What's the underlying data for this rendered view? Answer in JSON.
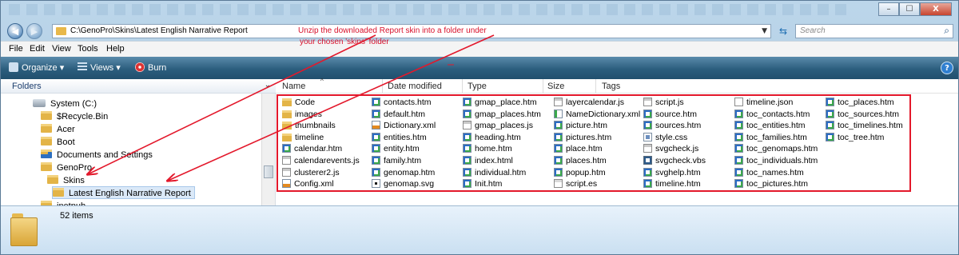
{
  "window": {
    "controls": {
      "minimize": "–",
      "maximize": "☐",
      "close": "X"
    }
  },
  "address": {
    "path": "C:\\GenoPro\\Skins\\Latest English Narrative Report",
    "search_placeholder": "Search"
  },
  "menu": [
    "File",
    "Edit",
    "View",
    "Tools",
    "Help"
  ],
  "toolbar": {
    "organize": "Organize",
    "views": "Views",
    "burn": "Burn",
    "help": "?"
  },
  "nav": {
    "header": "Folders",
    "items": [
      {
        "label": "System (C:)",
        "icon": "drive-icon"
      },
      {
        "label": "$Recycle.Bin",
        "icon": "folder-icon"
      },
      {
        "label": "Acer",
        "icon": "folder-icon"
      },
      {
        "label": "Boot",
        "icon": "folder-icon"
      },
      {
        "label": "Documents and Settings",
        "icon": "folder-shortcut-icon"
      },
      {
        "label": "GenoPro",
        "icon": "folder-icon"
      },
      {
        "label": "Skins",
        "icon": "folder-icon"
      },
      {
        "label": "Latest English Narrative Report",
        "icon": "folder-icon"
      },
      {
        "label": "inetpub",
        "icon": "folder-icon"
      }
    ]
  },
  "columns": [
    "Name",
    "Date modified",
    "Type",
    "Size",
    "Tags"
  ],
  "files": [
    [
      {
        "name": "Code",
        "type": "folder"
      },
      {
        "name": "images",
        "type": "folder"
      },
      {
        "name": "thumbnails",
        "type": "folder"
      },
      {
        "name": "timeline",
        "type": "folder"
      },
      {
        "name": "calendar.htm",
        "type": "htm"
      },
      {
        "name": "calendarevents.js",
        "type": "js"
      },
      {
        "name": "clusterer2.js",
        "type": "js"
      },
      {
        "name": "Config.xml",
        "type": "xml"
      }
    ],
    [
      {
        "name": "contacts.htm",
        "type": "htm"
      },
      {
        "name": "default.htm",
        "type": "htm"
      },
      {
        "name": "Dictionary.xml",
        "type": "xml"
      },
      {
        "name": "entities.htm",
        "type": "htm"
      },
      {
        "name": "entity.htm",
        "type": "htm"
      },
      {
        "name": "family.htm",
        "type": "htm"
      },
      {
        "name": "genomap.htm",
        "type": "htm"
      },
      {
        "name": "genomap.svg",
        "type": "svg"
      }
    ],
    [
      {
        "name": "gmap_place.htm",
        "type": "htm"
      },
      {
        "name": "gmap_places.htm",
        "type": "htm"
      },
      {
        "name": "gmap_places.js",
        "type": "js"
      },
      {
        "name": "heading.htm",
        "type": "htm"
      },
      {
        "name": "home.htm",
        "type": "htm"
      },
      {
        "name": "index.html",
        "type": "htm"
      },
      {
        "name": "individual.htm",
        "type": "htm"
      },
      {
        "name": "Init.htm",
        "type": "htm"
      }
    ],
    [
      {
        "name": "layercalendar.js",
        "type": "js"
      },
      {
        "name": "NameDictionary.xml",
        "type": "dic"
      },
      {
        "name": "picture.htm",
        "type": "htm"
      },
      {
        "name": "pictures.htm",
        "type": "htm"
      },
      {
        "name": "place.htm",
        "type": "htm"
      },
      {
        "name": "places.htm",
        "type": "htm"
      },
      {
        "name": "popup.htm",
        "type": "htm"
      },
      {
        "name": "script.es",
        "type": "es"
      }
    ],
    [
      {
        "name": "script.js",
        "type": "js"
      },
      {
        "name": "source.htm",
        "type": "htm"
      },
      {
        "name": "sources.htm",
        "type": "htm"
      },
      {
        "name": "style.css",
        "type": "css"
      },
      {
        "name": "svgcheck.js",
        "type": "js"
      },
      {
        "name": "svgcheck.vbs",
        "type": "vbs"
      },
      {
        "name": "svghelp.htm",
        "type": "htm"
      },
      {
        "name": "timeline.htm",
        "type": "htm"
      }
    ],
    [
      {
        "name": "timeline.json",
        "type": "txt"
      },
      {
        "name": "toc_contacts.htm",
        "type": "htm"
      },
      {
        "name": "toc_entities.htm",
        "type": "htm"
      },
      {
        "name": "toc_families.htm",
        "type": "htm"
      },
      {
        "name": "toc_genomaps.htm",
        "type": "htm"
      },
      {
        "name": "toc_individuals.htm",
        "type": "htm"
      },
      {
        "name": "toc_names.htm",
        "type": "htm"
      },
      {
        "name": "toc_pictures.htm",
        "type": "htm"
      }
    ],
    [
      {
        "name": "toc_places.htm",
        "type": "htm"
      },
      {
        "name": "toc_sources.htm",
        "type": "htm"
      },
      {
        "name": "toc_timelines.htm",
        "type": "htm"
      },
      {
        "name": "toc_tree.htm",
        "type": "htm"
      }
    ]
  ],
  "details": {
    "item_count": "52 items"
  },
  "annotation": {
    "line1": "Unzip the downloaded Report skin into a folder under",
    "line2": "your chosen 'skins' folder"
  },
  "colors": {
    "annotation_red": "#e3182b"
  }
}
